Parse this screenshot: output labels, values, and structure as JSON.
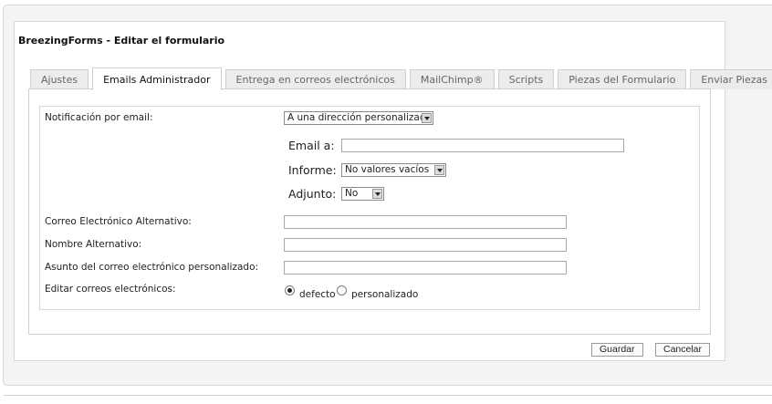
{
  "page": {
    "title": "BreezingForms - Editar el formulario"
  },
  "tabs": [
    {
      "label": "Ajustes",
      "active": false
    },
    {
      "label": "Emails Administrador",
      "active": true
    },
    {
      "label": "Entrega en correos electrónicos",
      "active": false
    },
    {
      "label": "MailChimp®",
      "active": false
    },
    {
      "label": "Scripts",
      "active": false
    },
    {
      "label": "Piezas del Formulario",
      "active": false
    },
    {
      "label": "Enviar Piezas",
      "active": false
    }
  ],
  "form": {
    "notification": {
      "label": "Notificación por email:",
      "value": "A una dirección personalizada"
    },
    "email_to": {
      "label": "Email a:",
      "value": ""
    },
    "report": {
      "label": "Informe:",
      "value": "No valores vacíos"
    },
    "attachment": {
      "label": "Adjunto:",
      "value": "No"
    },
    "alt_email": {
      "label": "Correo Electrónico Alternativo:",
      "value": ""
    },
    "alt_name": {
      "label": "Nombre Alternativo:",
      "value": ""
    },
    "custom_subject": {
      "label": "Asunto del correo electrónico personalizado:",
      "value": ""
    },
    "edit_emails": {
      "label": "Editar correos electrónicos:",
      "options": [
        {
          "label": "defecto",
          "checked": true
        },
        {
          "label": "personalizado",
          "checked": false
        }
      ]
    }
  },
  "actions": {
    "save_label": "Guardar",
    "cancel_label": "Cancelar"
  }
}
